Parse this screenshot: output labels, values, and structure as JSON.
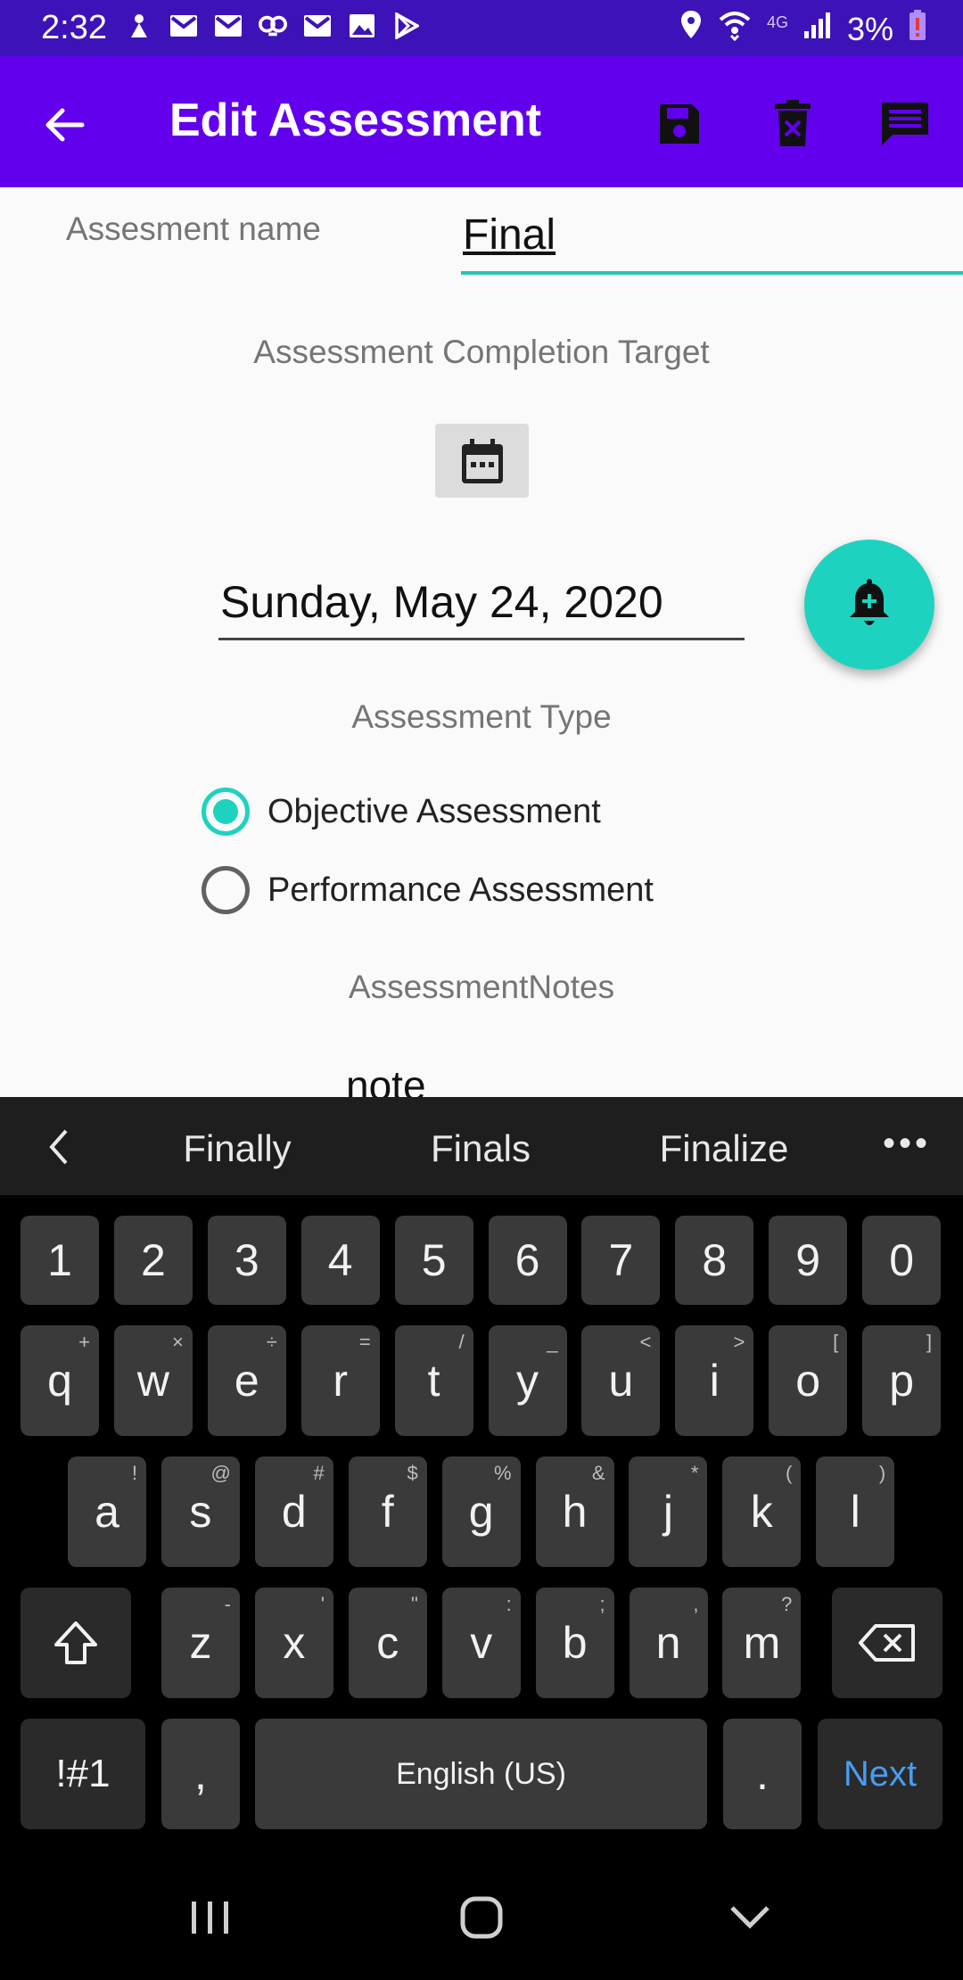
{
  "status_bar": {
    "time": "2:32",
    "battery": "3%",
    "network": "4G",
    "icons_left": [
      "notification-icon",
      "gmail-icon",
      "gmail-icon",
      "owl-icon",
      "gmail-icon",
      "image-icon",
      "play-store-icon"
    ],
    "icons_right": [
      "location-icon",
      "wifi-icon",
      "signal-icon",
      "battery-low-icon"
    ]
  },
  "app_bar": {
    "title": "Edit Assessment",
    "color": "#6200ee",
    "actions": [
      "save-icon",
      "delete-icon",
      "comment-icon"
    ]
  },
  "form": {
    "name_label": "Assesment name",
    "name_value": "Final",
    "completion_label": "Assessment Completion Target",
    "date_value": "Sunday, May 24, 2020",
    "type_label": "Assessment Type",
    "type_options": [
      {
        "label": "Objective Assessment",
        "checked": true
      },
      {
        "label": "Performance Assessment",
        "checked": false
      }
    ],
    "notes_label": "AssessmentNotes",
    "notes_value": "note",
    "accent": "#1dd3c0"
  },
  "keyboard": {
    "suggestions": [
      "Finally",
      "Finals",
      "Finalize"
    ],
    "number_row": [
      "1",
      "2",
      "3",
      "4",
      "5",
      "6",
      "7",
      "8",
      "9",
      "0"
    ],
    "row1": [
      [
        "q",
        "+"
      ],
      [
        "w",
        "×"
      ],
      [
        "e",
        "÷"
      ],
      [
        "r",
        "="
      ],
      [
        "t",
        "/"
      ],
      [
        "y",
        "_"
      ],
      [
        "u",
        "<"
      ],
      [
        "i",
        ">"
      ],
      [
        "o",
        "["
      ],
      [
        "p",
        "]"
      ]
    ],
    "row2": [
      [
        "a",
        "!"
      ],
      [
        "s",
        "@"
      ],
      [
        "d",
        "#"
      ],
      [
        "f",
        "$"
      ],
      [
        "g",
        "%"
      ],
      [
        "h",
        "&"
      ],
      [
        "j",
        "*"
      ],
      [
        "k",
        "("
      ],
      [
        "l",
        ")"
      ]
    ],
    "row3": [
      [
        "z",
        "-"
      ],
      [
        "x",
        "'"
      ],
      [
        "c",
        "\""
      ],
      [
        "v",
        ":"
      ],
      [
        "b",
        ";"
      ],
      [
        "n",
        ","
      ],
      [
        "m",
        "?"
      ]
    ],
    "sym_label": "!#1",
    "comma": ",",
    "space_label": "English (US)",
    "period": ".",
    "next_label": "Next"
  }
}
